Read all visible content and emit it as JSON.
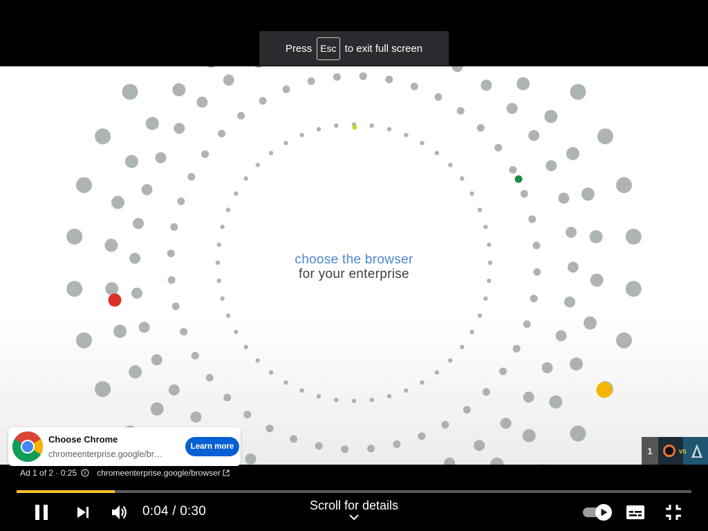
{
  "fullscreen_hint": {
    "press": "Press",
    "key": "Esc",
    "suffix": "to exit full screen"
  },
  "video": {
    "tagline_line1": "choose the browser",
    "tagline_line2": "for your enterprise",
    "colors": {
      "blue": "#4a86d4",
      "dark": "#3c4043",
      "dot_grey": "#9aa29c",
      "accent_red": "#d93025",
      "accent_green": "#1e8e3e",
      "accent_yellow": "#f2b705",
      "accent_lime": "#c6d51a"
    }
  },
  "ad_card": {
    "title": "Choose Chrome",
    "url": "chromeenterprise.google/br…",
    "cta": "Learn more",
    "icon": "chrome-logo-icon"
  },
  "ad_info": {
    "counter": "Ad 1 of 2 · 0:25",
    "url": "chromeenterprise.google/browser",
    "icons": [
      "info-icon",
      "external-link-icon"
    ]
  },
  "endscreen": {
    "count": "1"
  },
  "player": {
    "time": "0:04 / 0:30",
    "scroll_hint": "Scroll for details",
    "progress_fraction": 0.146,
    "progress_color": "#fbc02d",
    "icons": [
      "pause-icon",
      "next-icon",
      "volume-icon",
      "autoplay-toggle-icon",
      "subtitles-icon",
      "exit-fullscreen-icon"
    ]
  }
}
